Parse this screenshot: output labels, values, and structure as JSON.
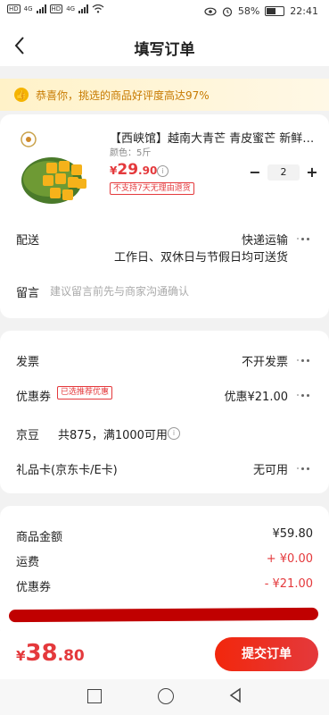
{
  "status_bar": {
    "hd_labels": [
      "HD",
      "HD"
    ],
    "signal_labels": [
      "4G",
      "4G"
    ],
    "battery": "58%",
    "time": "22:41"
  },
  "header": {
    "title": "填写订单"
  },
  "banner": {
    "text": "恭喜你，挑选的商品好评度高达97%"
  },
  "product": {
    "title": "【西峡馆】越南大青芒 青皮蜜芒 新鲜水果",
    "spec": "颜色：5斤",
    "price_symbol": "¥",
    "price_int": "29",
    "price_dec": ".90",
    "return_tag": "不支持7天无理由退货",
    "quantity": "2",
    "minus": "−",
    "plus": "+"
  },
  "delivery": {
    "label": "配送",
    "method": "快递运输",
    "time": "工作日、双休日与节假日均可送货"
  },
  "remark": {
    "label": "留言",
    "placeholder": "建议留言前先与商家沟通确认"
  },
  "invoice": {
    "label": "发票",
    "value": "不开发票"
  },
  "coupon": {
    "label": "优惠券",
    "badge": "已选推荐优惠",
    "value": "优惠¥21.00"
  },
  "jingdou": {
    "label": "京豆",
    "info": "共875，满1000可用"
  },
  "gift_card": {
    "label": "礼品卡(京东卡/E卡)",
    "value": "无可用"
  },
  "summary": {
    "goods_label": "商品金额",
    "goods_value": "¥59.80",
    "shipping_label": "运费",
    "shipping_value": "+ ¥0.00",
    "coupon_label": "优惠券",
    "coupon_value": "- ¥21.00"
  },
  "footer": {
    "total_symbol": "¥",
    "total_int": "38",
    "total_dec": ".80",
    "submit_label": "提交订单"
  },
  "colors": {
    "accent": "#e4393c",
    "banner_text": "#c77a00",
    "banner_bg": "#fff2c8"
  },
  "icons": [
    "back-icon",
    "thumbs-up-icon",
    "info-icon",
    "more-dots-icon",
    "square-nav-icon",
    "circle-nav-icon",
    "triangle-nav-icon"
  ]
}
